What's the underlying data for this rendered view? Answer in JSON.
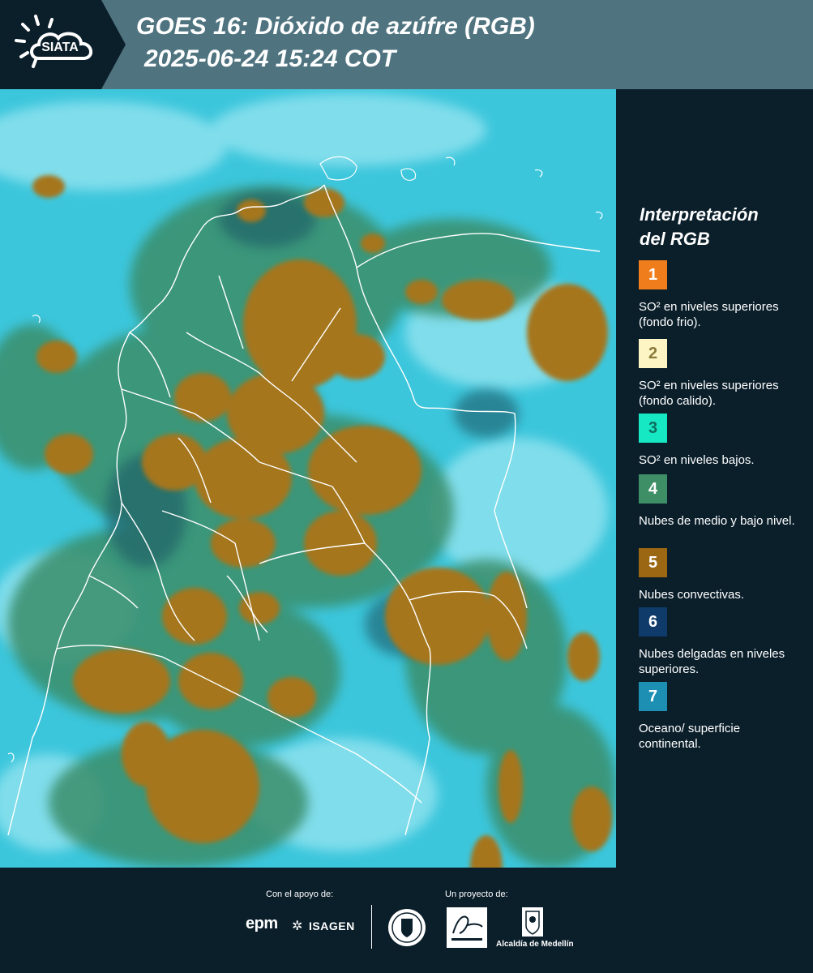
{
  "header": {
    "logo_text": "SIATA",
    "title_line1": "GOES 16: Dióxido de azúfre (RGB)",
    "title_line2": "2025-06-24 15:24 COT"
  },
  "legend": {
    "title_line1": "Interpretación",
    "title_line2": "del RGB",
    "items": [
      {
        "number": "1",
        "color": "#f07d1c",
        "number_color": "#ffffff",
        "label": "SO² en niveles superiores (fondo frio)."
      },
      {
        "number": "2",
        "color": "#fdf5c4",
        "number_color": "#8a7a3a",
        "label": "SO² en niveles superiores (fondo calido)."
      },
      {
        "number": "3",
        "color": "#16e8c4",
        "number_color": "#0e6a5c",
        "label": "SO² en niveles bajos."
      },
      {
        "number": "4",
        "color": "#3e8e66",
        "number_color": "#ffffff",
        "label": "Nubes de medio y bajo nivel."
      },
      {
        "number": "5",
        "color": "#9c6712",
        "number_color": "#ffffff",
        "label": "Nubes convectivas."
      },
      {
        "number": "6",
        "color": "#0f3b6a",
        "number_color": "#ffffff",
        "label": "Nubes delgadas en niveles superiores."
      },
      {
        "number": "7",
        "color": "#1c8fb3",
        "number_color": "#ffffff",
        "label": "Oceano/ superficie continental."
      }
    ]
  },
  "footer": {
    "support_label": "Con el apoyo de:",
    "project_label": "Un proyecto de:",
    "epm_text": "epm",
    "isagen_text": "ISAGEN",
    "alcaldia_text": "Alcaldía de Medellín"
  }
}
